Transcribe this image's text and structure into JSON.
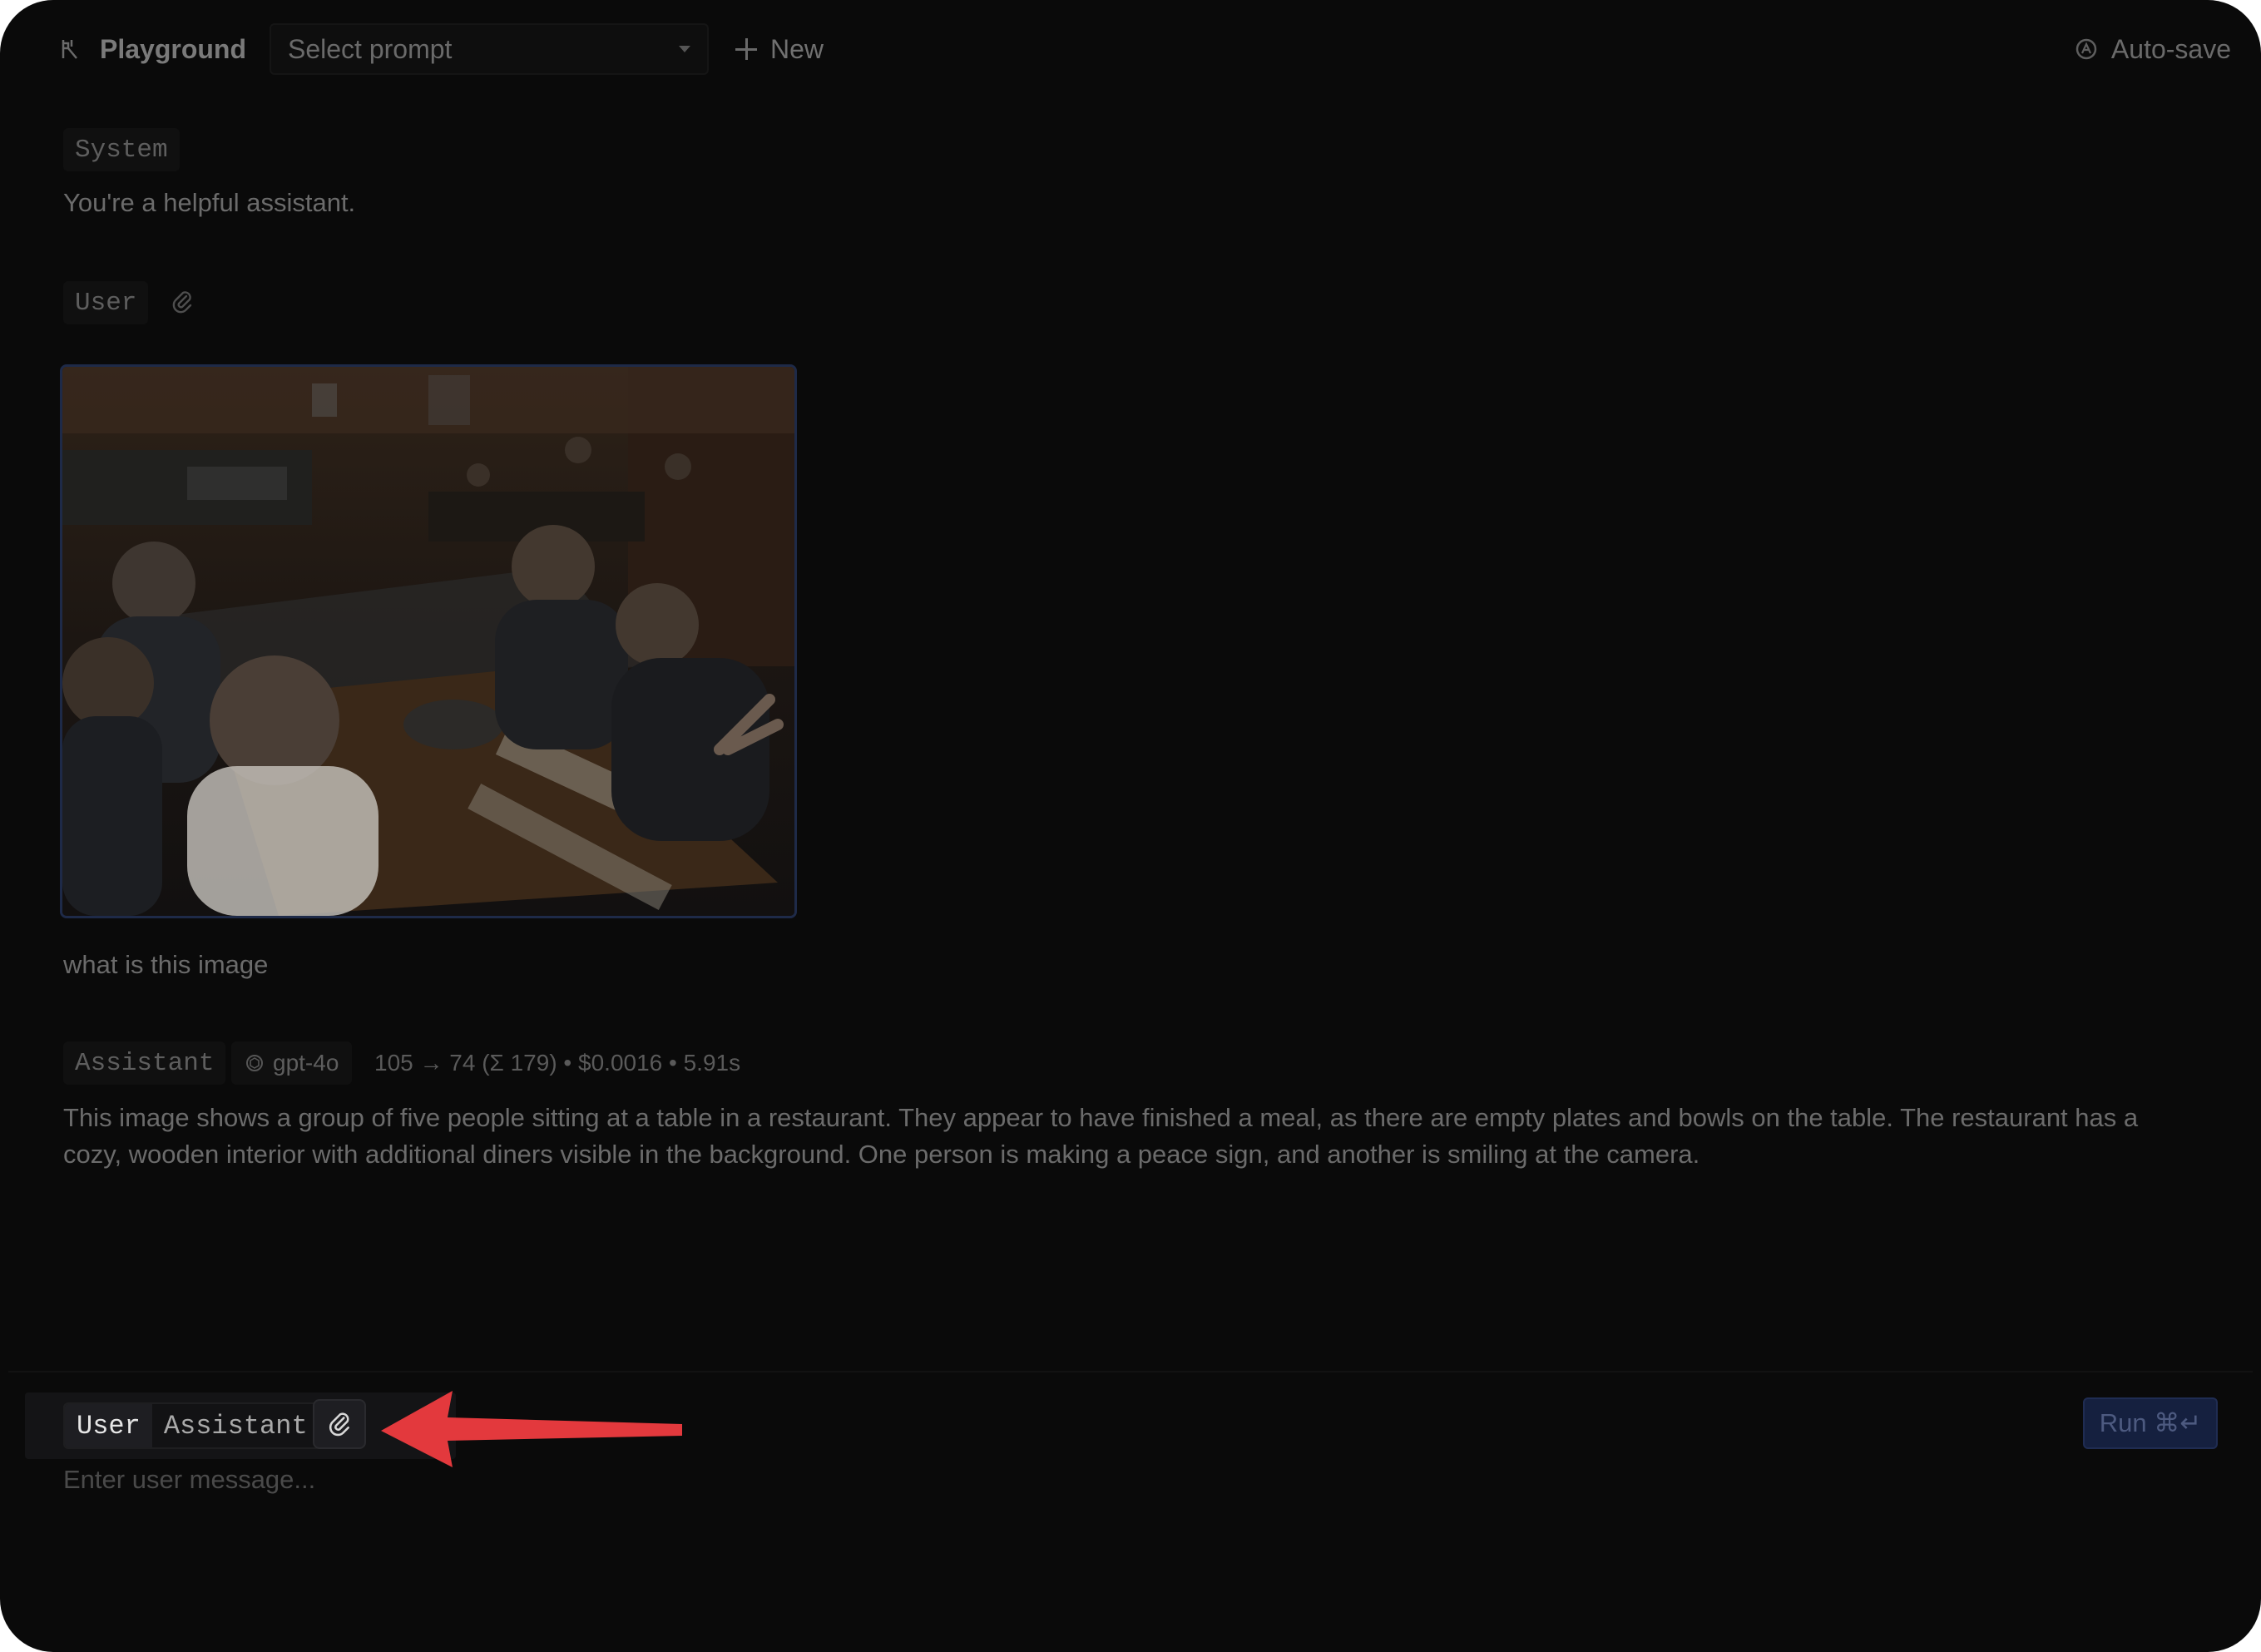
{
  "header": {
    "app_title": "Playground",
    "prompt_select": {
      "value": "Select prompt"
    },
    "new_label": "New",
    "autosave_label": "Auto-save"
  },
  "messages": [
    {
      "role": "System",
      "text": "You're a helpful assistant."
    },
    {
      "role": "User",
      "text": "what is this image"
    },
    {
      "role": "Assistant",
      "model": "gpt-4o",
      "stats": "105 → 74 (Σ 179) • $0.0016 • 5.91s",
      "text_line1": "This image shows a group of five people sitting at a table in a restaurant. They appear to have finished a meal, as there are empty plates and bowls on the table. The restaurant has a",
      "text_line2": "cozy, wooden interior with additional diners visible in the background. One person is making a peace sign, and another is smiling at the camera."
    }
  ],
  "composer": {
    "roles": [
      "User",
      "Assistant"
    ],
    "selected_role": "User",
    "placeholder": "Enter user message...",
    "run_label": "Run ⌘↵"
  },
  "colors": {
    "background": "#0a0a0a",
    "accent_run": "#15203f",
    "annotation_arrow": "#e3393d"
  },
  "icons": [
    "playground-icon",
    "caret-down-icon",
    "plus-icon",
    "autosave-icon",
    "paperclip-icon",
    "openai-icon"
  ]
}
